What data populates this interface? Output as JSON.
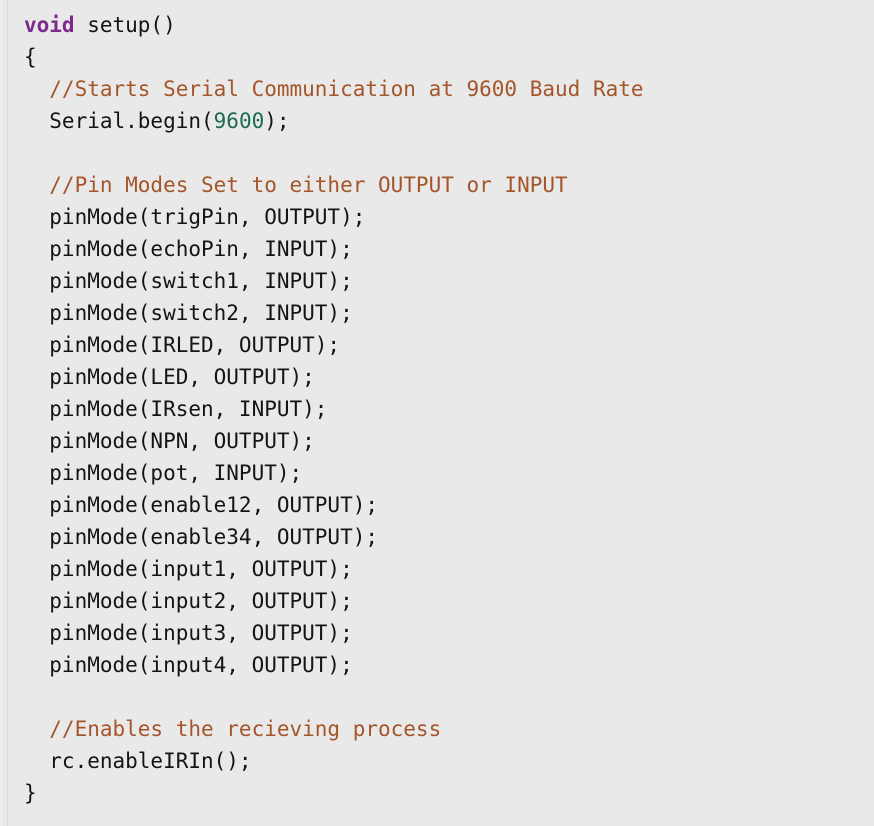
{
  "view": {
    "kind": "source-code-block",
    "language": "arduino-c",
    "background_color": "#e9e9e9",
    "gutter_divider_color": "#dcdcdc"
  },
  "theme": {
    "plain_color": "#141414",
    "keyword_color": "#7d2a8e",
    "comment_color": "#a4552a",
    "number_color": "#1a6b52"
  },
  "code": {
    "lines": [
      {
        "n": 1,
        "tokens": [
          {
            "t": "void",
            "c": "keyword"
          },
          {
            "t": " setup()",
            "c": "plain"
          }
        ]
      },
      {
        "n": 2,
        "tokens": [
          {
            "t": "{",
            "c": "plain"
          }
        ]
      },
      {
        "n": 3,
        "tokens": [
          {
            "t": "  //Starts Serial Communication at 9600 Baud Rate",
            "c": "comment"
          }
        ]
      },
      {
        "n": 4,
        "tokens": [
          {
            "t": "  Serial.begin(",
            "c": "plain"
          },
          {
            "t": "9600",
            "c": "number"
          },
          {
            "t": ");",
            "c": "plain"
          }
        ]
      },
      {
        "n": 5,
        "tokens": [
          {
            "t": "",
            "c": "blank"
          }
        ]
      },
      {
        "n": 6,
        "tokens": [
          {
            "t": "  //Pin Modes Set to either OUTPUT or INPUT",
            "c": "comment"
          }
        ]
      },
      {
        "n": 7,
        "tokens": [
          {
            "t": "  pinMode(trigPin, OUTPUT);",
            "c": "plain"
          }
        ]
      },
      {
        "n": 8,
        "tokens": [
          {
            "t": "  pinMode(echoPin, INPUT);",
            "c": "plain"
          }
        ]
      },
      {
        "n": 9,
        "tokens": [
          {
            "t": "  pinMode(switch1, INPUT);",
            "c": "plain"
          }
        ]
      },
      {
        "n": 10,
        "tokens": [
          {
            "t": "  pinMode(switch2, INPUT);",
            "c": "plain"
          }
        ]
      },
      {
        "n": 11,
        "tokens": [
          {
            "t": "  pinMode(IRLED, OUTPUT);",
            "c": "plain"
          }
        ]
      },
      {
        "n": 12,
        "tokens": [
          {
            "t": "  pinMode(LED, OUTPUT);",
            "c": "plain"
          }
        ]
      },
      {
        "n": 13,
        "tokens": [
          {
            "t": "  pinMode(IRsen, INPUT);",
            "c": "plain"
          }
        ]
      },
      {
        "n": 14,
        "tokens": [
          {
            "t": "  pinMode(NPN, OUTPUT);",
            "c": "plain"
          }
        ]
      },
      {
        "n": 15,
        "tokens": [
          {
            "t": "  pinMode(pot, INPUT);",
            "c": "plain"
          }
        ]
      },
      {
        "n": 16,
        "tokens": [
          {
            "t": "  pinMode(enable12, OUTPUT);",
            "c": "plain"
          }
        ]
      },
      {
        "n": 17,
        "tokens": [
          {
            "t": "  pinMode(enable34, OUTPUT);",
            "c": "plain"
          }
        ]
      },
      {
        "n": 18,
        "tokens": [
          {
            "t": "  pinMode(input1, OUTPUT);",
            "c": "plain"
          }
        ]
      },
      {
        "n": 19,
        "tokens": [
          {
            "t": "  pinMode(input2, OUTPUT);",
            "c": "plain"
          }
        ]
      },
      {
        "n": 20,
        "tokens": [
          {
            "t": "  pinMode(input3, OUTPUT);",
            "c": "plain"
          }
        ]
      },
      {
        "n": 21,
        "tokens": [
          {
            "t": "  pinMode(input4, OUTPUT);",
            "c": "plain"
          }
        ]
      },
      {
        "n": 22,
        "tokens": [
          {
            "t": "",
            "c": "blank"
          }
        ]
      },
      {
        "n": 23,
        "tokens": [
          {
            "t": "  //Enables the recieving process",
            "c": "comment"
          }
        ]
      },
      {
        "n": 24,
        "tokens": [
          {
            "t": "  rc.enableIRIn();",
            "c": "plain"
          }
        ]
      },
      {
        "n": 25,
        "tokens": [
          {
            "t": "}",
            "c": "plain"
          }
        ]
      }
    ]
  }
}
